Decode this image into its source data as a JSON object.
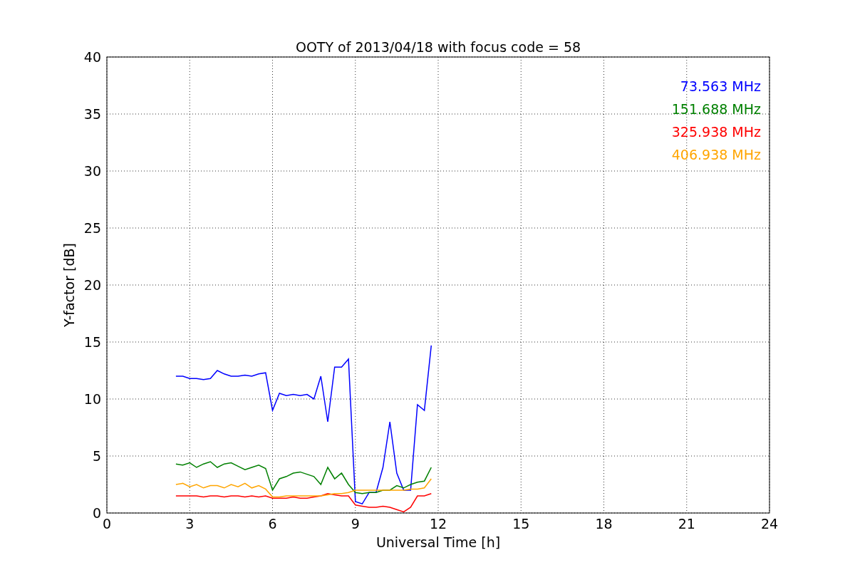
{
  "chart": {
    "chart_data": {
      "type": "line",
      "title": "OOTY of 2013/04/18 with focus code = 58",
      "xlabel": "Universal Time [h]",
      "ylabel": "Y-factor [dB]",
      "x": [
        2.5,
        2.75,
        3,
        3.25,
        3.5,
        3.75,
        4,
        4.25,
        4.5,
        4.75,
        5,
        5.25,
        5.5,
        5.75,
        6,
        6.25,
        6.5,
        6.75,
        7,
        7.25,
        7.5,
        7.75,
        8,
        8.25,
        8.5,
        8.75,
        9,
        9.25,
        9.5,
        9.75,
        10,
        10.25,
        10.5,
        10.75,
        11,
        11.25,
        11.5,
        11.75
      ],
      "series": [
        {
          "name": "73.563 MHz",
          "color": "#0000ff",
          "values": [
            12,
            12,
            11.8,
            11.8,
            11.7,
            11.8,
            12.5,
            12.2,
            12,
            12,
            12.1,
            12,
            12.2,
            12.3,
            9,
            10.5,
            10.3,
            10.4,
            10.3,
            10.4,
            10,
            12,
            8,
            12.8,
            12.8,
            13.5,
            1,
            0.8,
            1.8,
            1.8,
            4,
            8,
            3.5,
            2,
            2,
            9.5,
            9,
            14.7
          ]
        },
        {
          "name": "151.688 MHz",
          "color": "#008000",
          "values": [
            4.3,
            4.2,
            4.4,
            4,
            4.3,
            4.5,
            4,
            4.3,
            4.4,
            4.1,
            3.8,
            4,
            4.2,
            3.9,
            2,
            3,
            3.2,
            3.5,
            3.6,
            3.4,
            3.2,
            2.5,
            4,
            3,
            3.5,
            2.5,
            1.8,
            1.7,
            1.8,
            1.8,
            2,
            2,
            2.4,
            2.2,
            2.5,
            2.7,
            2.8,
            4
          ]
        },
        {
          "name": "325.938 MHz",
          "color": "#ff0000",
          "values": [
            1.5,
            1.5,
            1.5,
            1.5,
            1.4,
            1.5,
            1.5,
            1.4,
            1.5,
            1.5,
            1.4,
            1.5,
            1.4,
            1.5,
            1.3,
            1.3,
            1.3,
            1.4,
            1.3,
            1.3,
            1.4,
            1.5,
            1.7,
            1.6,
            1.5,
            1.5,
            0.7,
            0.6,
            0.5,
            0.5,
            0.6,
            0.5,
            0.3,
            0.1,
            0.5,
            1.5,
            1.5,
            1.7
          ]
        },
        {
          "name": "406.938 MHz",
          "color": "#ffa500",
          "values": [
            2.5,
            2.6,
            2.3,
            2.5,
            2.2,
            2.4,
            2.4,
            2.2,
            2.5,
            2.3,
            2.6,
            2.2,
            2.4,
            2.1,
            1.4,
            1.4,
            1.5,
            1.5,
            1.5,
            1.5,
            1.5,
            1.5,
            1.6,
            1.7,
            1.7,
            1.8,
            2,
            2,
            2,
            2,
            2,
            2,
            2,
            2,
            2.1,
            2.1,
            2.2,
            3
          ]
        }
      ],
      "xlim": [
        0,
        24
      ],
      "ylim": [
        0,
        40
      ],
      "xticks": [
        0,
        3,
        6,
        9,
        12,
        15,
        18,
        21,
        24
      ],
      "yticks": [
        0,
        5,
        10,
        15,
        20,
        25,
        30,
        35,
        40
      ],
      "grid": true
    }
  }
}
